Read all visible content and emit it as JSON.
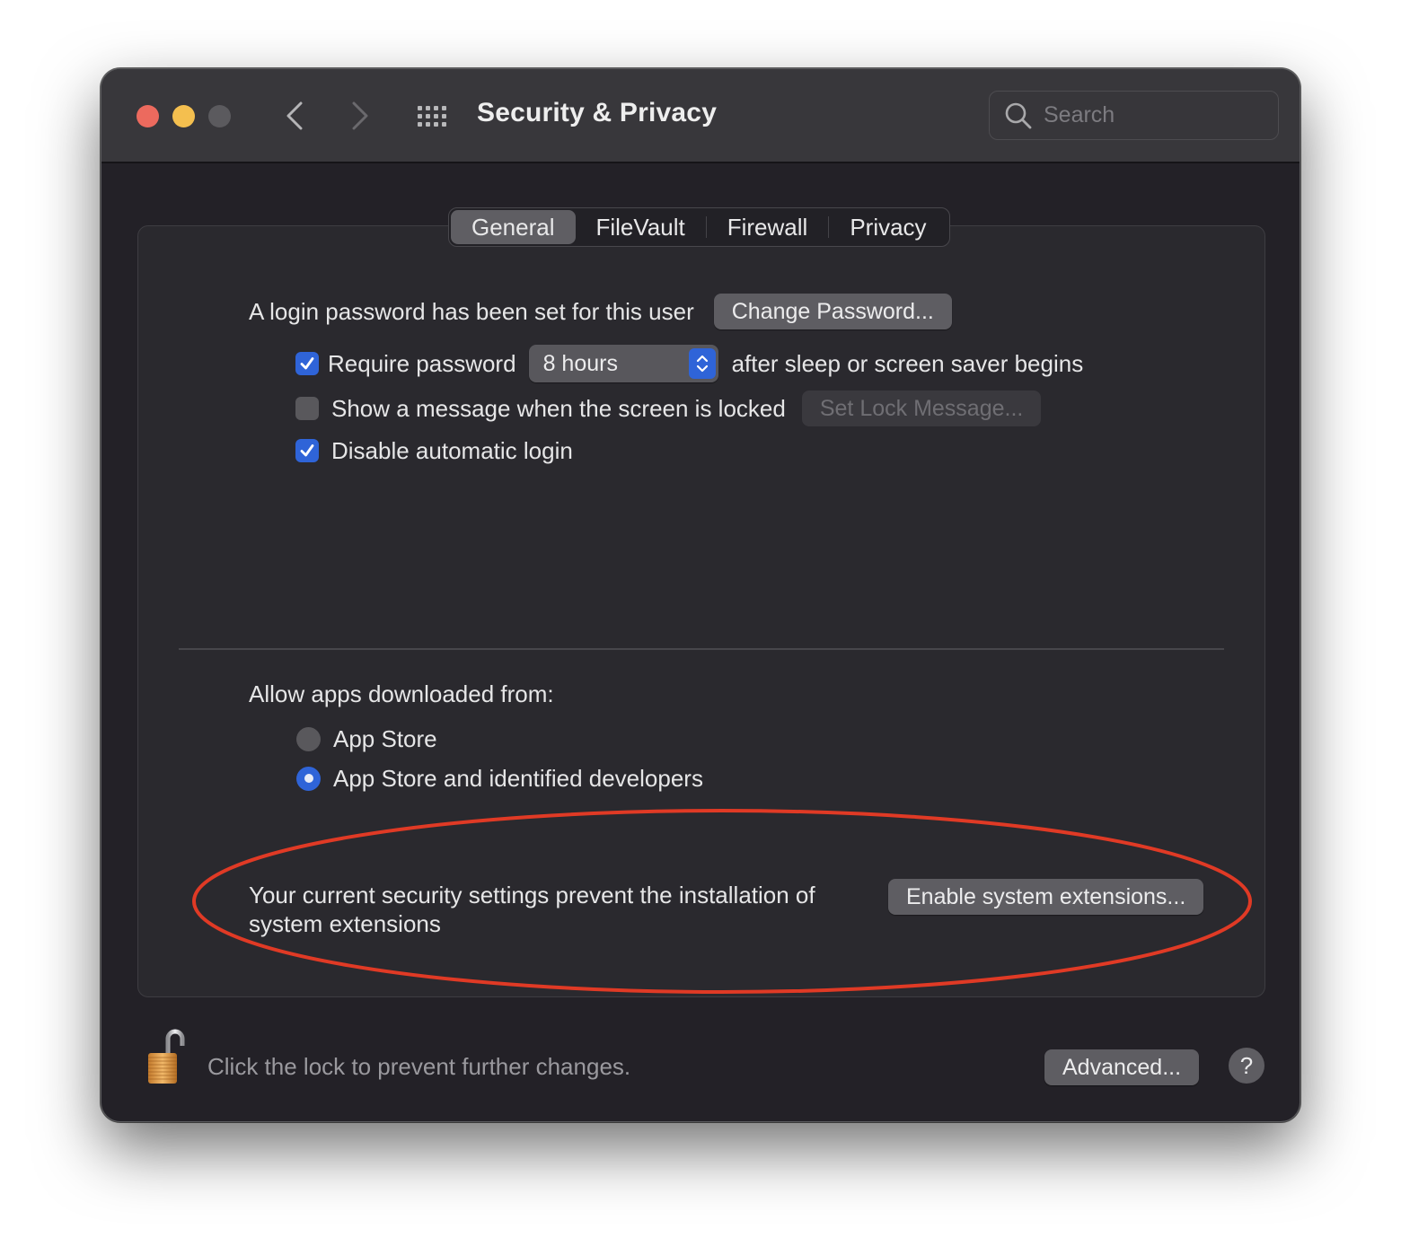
{
  "window": {
    "title": "Security & Privacy",
    "traffic_lights": {
      "close_color": "#ec6a5e",
      "minimize_color": "#f4bf4f",
      "zoom_color": "#5b5a5e"
    },
    "nav": {
      "back_icon": "chevron-left-icon",
      "forward_icon": "chevron-right-icon",
      "grid_icon": "show-all-grid-icon"
    },
    "search": {
      "placeholder": "Search",
      "value": "",
      "icon": "search-icon"
    }
  },
  "tabs": [
    {
      "label": "General",
      "active": true
    },
    {
      "label": "FileVault",
      "active": false
    },
    {
      "label": "Firewall",
      "active": false
    },
    {
      "label": "Privacy",
      "active": false
    }
  ],
  "general": {
    "login_password_text": "A login password has been set for this user",
    "change_password_button": "Change Password...",
    "require_password": {
      "label": "Require password",
      "checked": true,
      "select_value": "8 hours",
      "suffix": "after sleep or screen saver begins"
    },
    "show_message": {
      "label": "Show a message when the screen is locked",
      "checked": false,
      "button": "Set Lock Message...",
      "button_enabled": false
    },
    "disable_auto_login": {
      "label": "Disable automatic login",
      "checked": true
    },
    "allow_apps": {
      "heading": "Allow apps downloaded from:",
      "options": [
        {
          "label": "App Store",
          "selected": false
        },
        {
          "label": "App Store and identified developers",
          "selected": true
        }
      ]
    },
    "system_extensions": {
      "message": "Your current security settings prevent the installation of system extensions",
      "button": "Enable system extensions..."
    }
  },
  "annotation": {
    "shape": "ellipse",
    "color": "#e03a25",
    "target": "system-extensions-section"
  },
  "footer": {
    "lock_state": "unlocked",
    "lock_text": "Click the lock to prevent further changes.",
    "advanced_button": "Advanced...",
    "help_button": "?"
  },
  "colors": {
    "accent": "#2f64d8",
    "window_bg": "#232127",
    "panel_bg": "#2a292e",
    "titlebar_bg": "#38373b"
  }
}
